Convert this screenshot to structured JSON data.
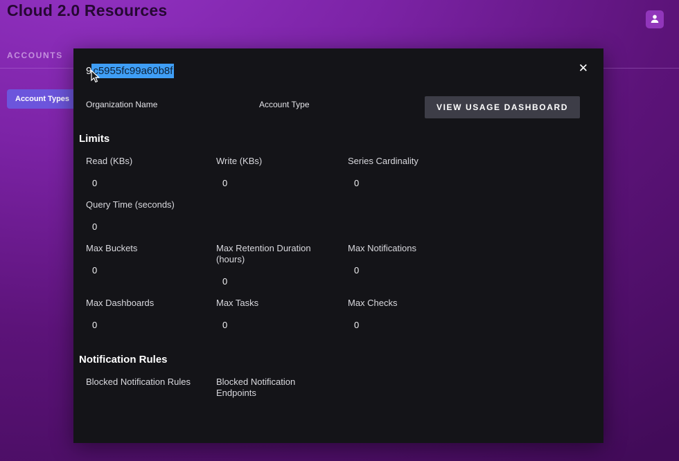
{
  "header": {
    "title": "Cloud 2.0 Resources",
    "avatar_icon": "person-icon"
  },
  "nav": {
    "accounts_label": "ACCOUNTS",
    "account_types_button": "Account Types"
  },
  "modal": {
    "account_id_prefix": "9",
    "account_id_selected": "c5955fc99a60b8f",
    "close_glyph": "✕",
    "organization_name_label": "Organization Name",
    "account_type_label": "Account Type",
    "view_usage_button": "VIEW USAGE DASHBOARD",
    "limits_title": "Limits",
    "limits_fields": [
      {
        "label": "Read (KBs)",
        "value": "0"
      },
      {
        "label": "Write (KBs)",
        "value": "0"
      },
      {
        "label": "Series Cardinality",
        "value": "0"
      },
      {
        "label": "Query Time (seconds)",
        "value": "0"
      },
      {
        "label": "Max Buckets",
        "value": "0"
      },
      {
        "label": "Max Retention Duration (hours)",
        "value": "0"
      },
      {
        "label": "Max Notifications",
        "value": "0"
      },
      {
        "label": "Max Dashboards",
        "value": "0"
      },
      {
        "label": "Max Tasks",
        "value": "0"
      },
      {
        "label": "Max Checks",
        "value": "0"
      }
    ],
    "notification_title": "Notification Rules",
    "notification_fields": [
      {
        "label": "Blocked Notification Rules"
      },
      {
        "label": "Blocked Notification Endpoints"
      }
    ]
  },
  "colors": {
    "background_purple": "#7c23a6",
    "accent_purple": "#6c55dc",
    "selection_blue": "#3f9ef5",
    "modal_background": "#141418",
    "button_gray": "#3d3d47"
  }
}
